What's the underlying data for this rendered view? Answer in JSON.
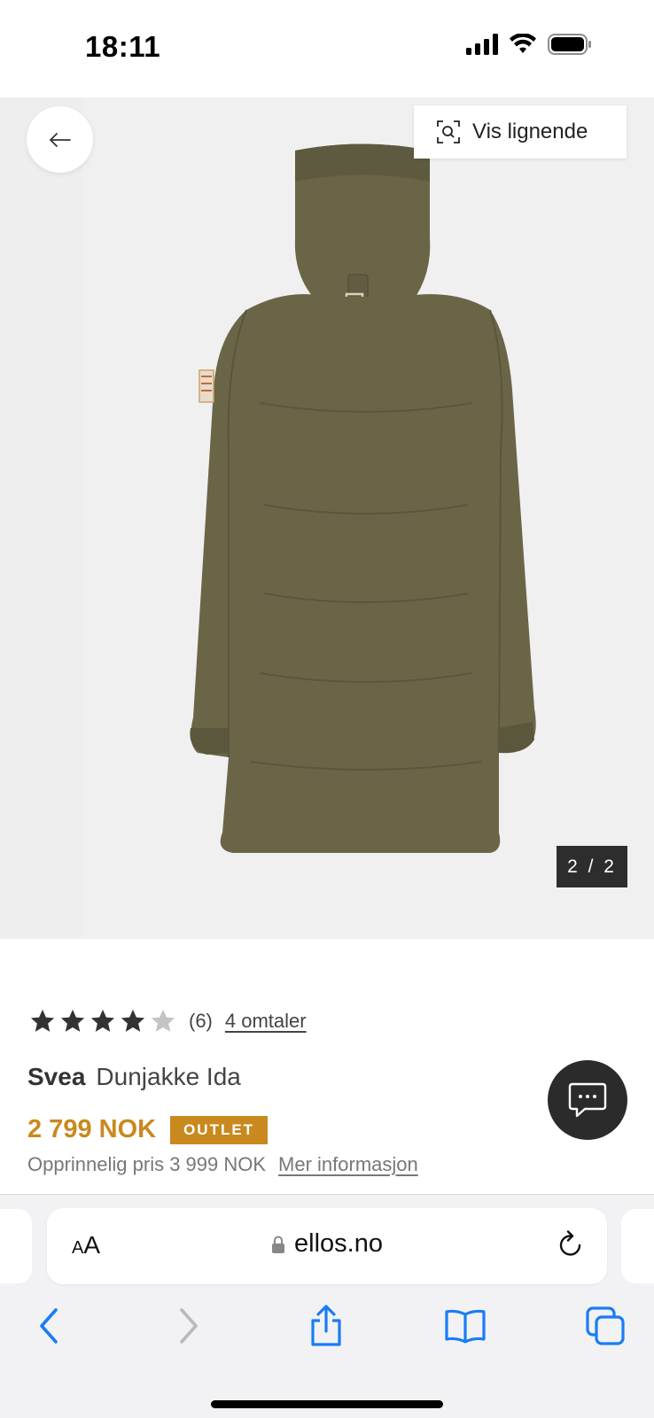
{
  "status": {
    "time": "18:11"
  },
  "gallery": {
    "similar_label": "Vis lignende",
    "counter": "2 / 2"
  },
  "product": {
    "rating": 4,
    "rating_max": 5,
    "rating_count": "(6)",
    "reviews_link": "4 omtaler",
    "brand": "Svea",
    "name": "Dunjakke Ida",
    "price": "2 799 NOK",
    "badge": "OUTLET",
    "original_price": "Opprinnelig pris 3 999 NOK",
    "more_info": "Mer informasjon"
  },
  "browser": {
    "text_size_label_small": "A",
    "text_size_label_large": "A",
    "url": "ellos.no"
  },
  "colors": {
    "accent": "#c9891f",
    "dark": "#2b2b2b",
    "safari_blue": "#1a7cf5",
    "jacket": "#6b6548"
  },
  "icons": {
    "back": "arrow-left-icon",
    "similar": "visual-search-icon",
    "chat": "chat-bubble-icon",
    "lock": "lock-icon",
    "reload": "reload-icon",
    "nav_back": "chevron-left-icon",
    "nav_forward": "chevron-right-icon",
    "share": "share-icon",
    "bookmarks": "book-icon",
    "tabs": "tabs-icon"
  }
}
